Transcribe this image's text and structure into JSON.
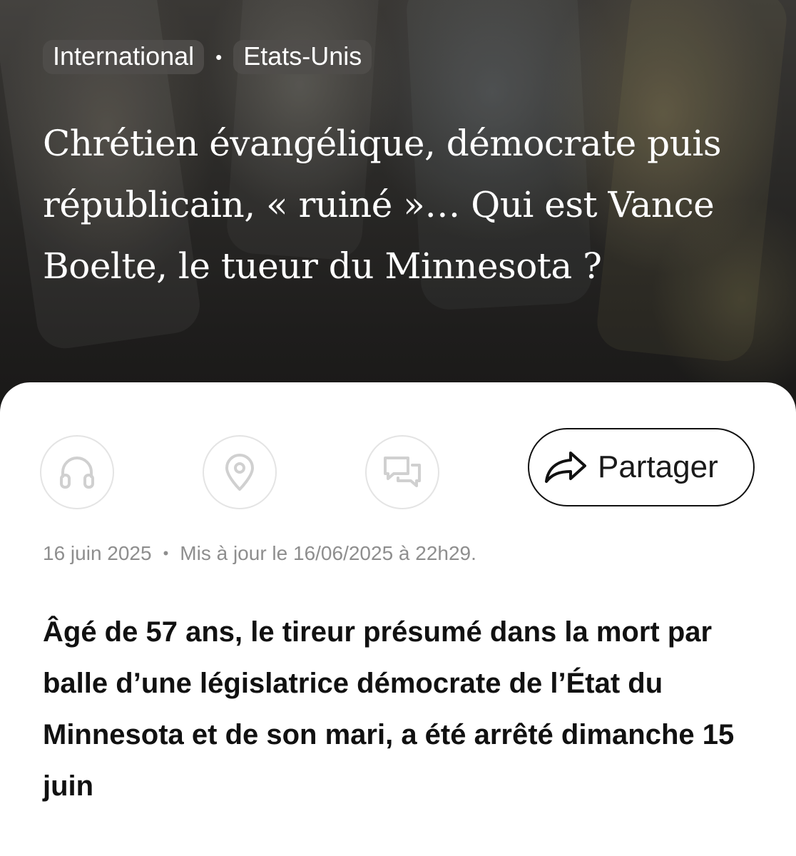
{
  "article": {
    "tags": [
      "International",
      "Etats-Unis"
    ],
    "tag_separator": "•",
    "headline": "Chrétien évangélique, démocrate puis républicain, « ruiné »… Qui est Vance Boelte, le tueur du Minnesota ?",
    "actions": {
      "listen_icon": "headphones-icon",
      "location_icon": "location-pin-icon",
      "comments_icon": "chat-bubbles-icon",
      "share_icon": "share-arrow-icon",
      "share_label": "Partager"
    },
    "date": "16 juin 2025",
    "meta_separator": "•",
    "updated": "Mis à jour le 16/06/2025 à 22h29.",
    "lead": "Âgé de 57 ans, le tireur présumé dans la mort par balle d’une législatrice démocrate de l’État du Minnesota et de son mari, a été arrêté dimanche 15 juin"
  },
  "colors": {
    "hero_dark": "#2a2927",
    "tag_bg": "#504e4b",
    "icon_gray": "#d0d0d0",
    "meta_gray": "#8e8e8e",
    "text_dark": "#111111"
  }
}
